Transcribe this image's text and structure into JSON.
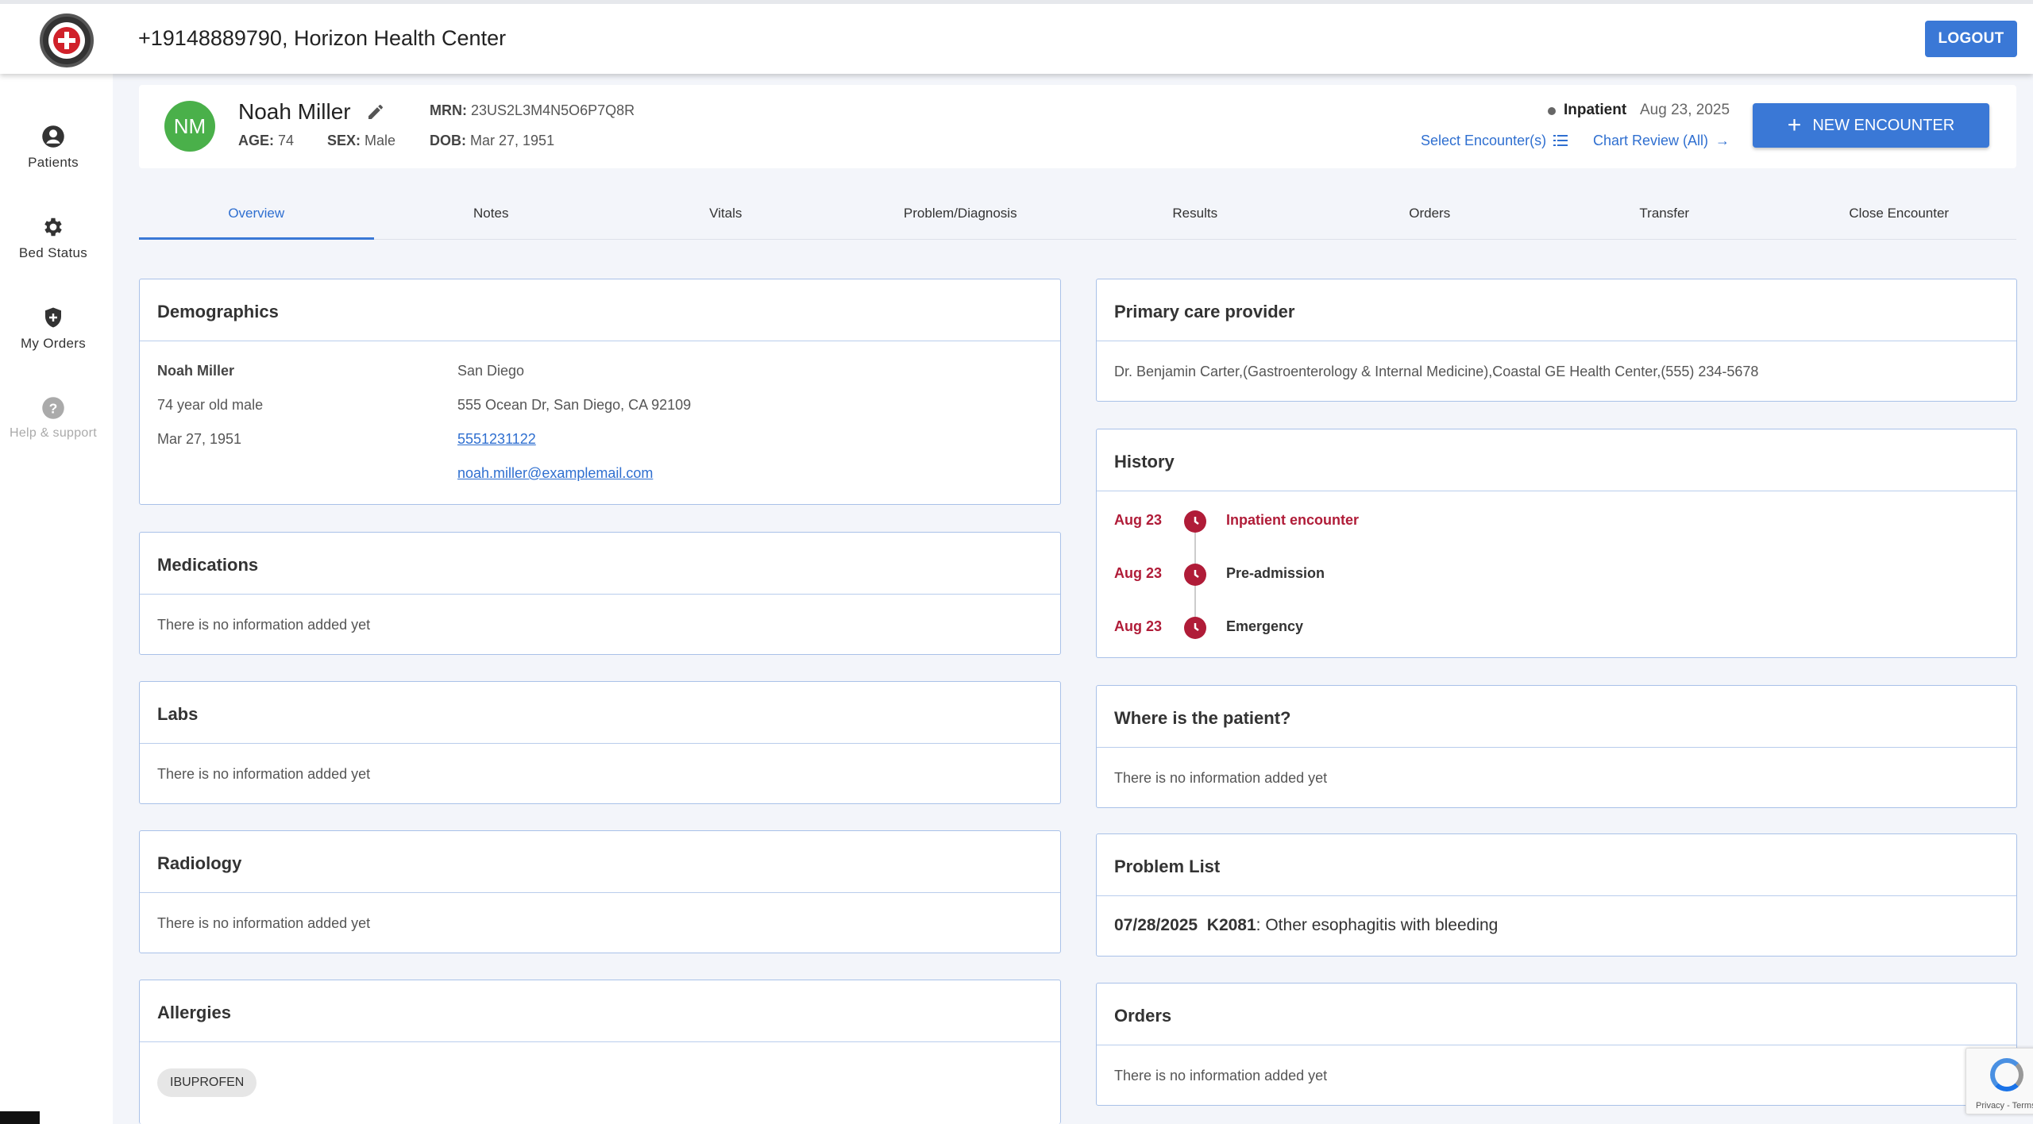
{
  "header": {
    "title": "+19148889790, Horizon Health Center",
    "logout_label": "LOGOUT"
  },
  "sidebar": {
    "items": [
      {
        "label": "Patients",
        "icon": "person-circle-icon"
      },
      {
        "label": "Bed Status",
        "icon": "gear-icon"
      },
      {
        "label": "My Orders",
        "icon": "shield-plus-icon"
      },
      {
        "label": "Help & support",
        "icon": "help-circle-icon"
      }
    ]
  },
  "patient": {
    "initials": "NM",
    "name": "Noah Miller",
    "age_label": "AGE:",
    "age": "74",
    "sex_label": "SEX:",
    "sex": "Male",
    "mrn_label": "MRN:",
    "mrn": "23US2L3M4N5O6P7Q8R",
    "dob_label": "DOB:",
    "dob": "Mar 27, 1951",
    "status": "Inpatient",
    "status_date": "Aug 23, 2025",
    "select_encounters": "Select Encounter(s)",
    "chart_review": "Chart Review (All)",
    "new_encounter": "NEW ENCOUNTER",
    "avatar_color": "#4ab04a"
  },
  "tabs": [
    {
      "label": "Overview",
      "active": true
    },
    {
      "label": "Notes"
    },
    {
      "label": "Vitals"
    },
    {
      "label": "Problem/Diagnosis"
    },
    {
      "label": "Results"
    },
    {
      "label": "Orders"
    },
    {
      "label": "Transfer"
    },
    {
      "label": "Close Encounter"
    }
  ],
  "demographics": {
    "title": "Demographics",
    "name": "Noah Miller",
    "age_sex": "74 year old male",
    "dob": "Mar 27, 1951",
    "city": "San Diego",
    "address": "555 Ocean Dr, San Diego, CA 92109",
    "phone": "5551231122",
    "email": "noah.miller@examplemail.com"
  },
  "empty_text": "There is no information added yet",
  "medications": {
    "title": "Medications"
  },
  "labs": {
    "title": "Labs"
  },
  "radiology": {
    "title": "Radiology"
  },
  "allergies": {
    "title": "Allergies",
    "items": [
      "IBUPROFEN"
    ]
  },
  "pcp": {
    "title": "Primary care provider",
    "text": "Dr. Benjamin Carter,(Gastroenterology & Internal Medicine),Coastal GE Health Center,(555) 234-5678"
  },
  "history": {
    "title": "History",
    "items": [
      {
        "date": "Aug 23",
        "label": "Inpatient encounter"
      },
      {
        "date": "Aug 23",
        "label": "Pre-admission"
      },
      {
        "date": "Aug 23",
        "label": "Emergency"
      }
    ],
    "accent": "#b01c38"
  },
  "where": {
    "title": "Where is the patient?"
  },
  "problem_list": {
    "title": "Problem List",
    "date": "07/28/2025",
    "code": "K2081",
    "desc": ": Other esophagitis with bleeding"
  },
  "orders": {
    "title": "Orders"
  },
  "recaptcha": {
    "text": "Privacy - Terms"
  },
  "colors": {
    "primary": "#3a78d6",
    "link": "#2f6fd0"
  }
}
